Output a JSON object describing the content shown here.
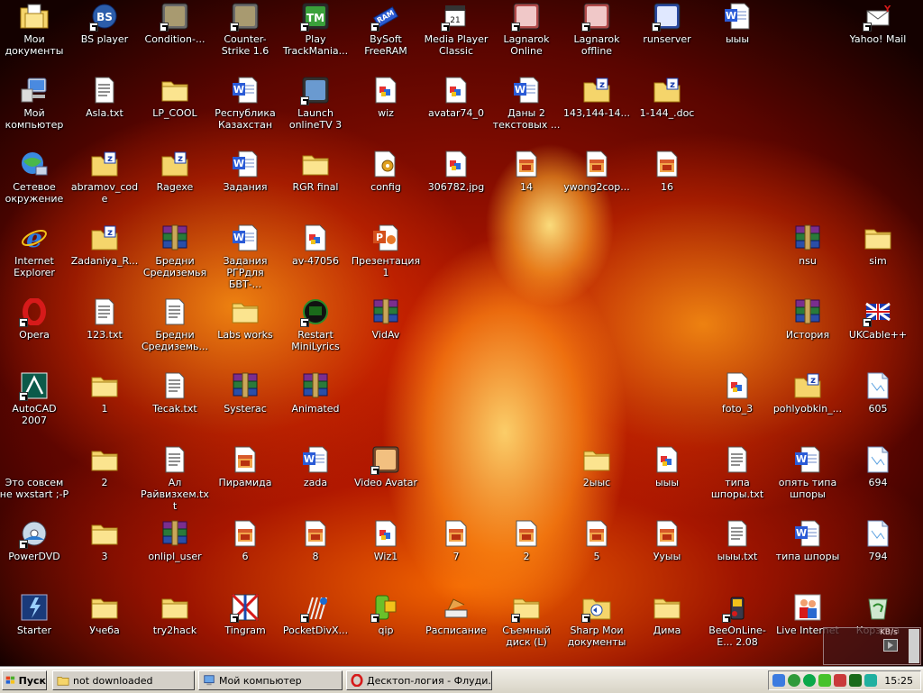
{
  "desktop": {
    "icons": [
      {
        "label": "Мои документы",
        "icon": "my-documents-icon",
        "type": "mydocs",
        "shortcut": false
      },
      {
        "label": "BS player",
        "icon": "bsplayer-icon",
        "type": "app-bs",
        "shortcut": true
      },
      {
        "label": "Condition-...",
        "icon": "counter-strike-icon",
        "type": "app-cs",
        "shortcut": true
      },
      {
        "label": "Counter-Strike 1.6",
        "icon": "counter-strike-icon",
        "type": "app-cs",
        "shortcut": true
      },
      {
        "label": "Play TrackMania...",
        "icon": "trackmania-icon",
        "type": "app-tm",
        "shortcut": true
      },
      {
        "label": "BySoft FreeRAM",
        "icon": "freeram-icon",
        "type": "app-ram",
        "shortcut": true
      },
      {
        "label": "Media Player Classic",
        "icon": "media-player-icon",
        "type": "app-mpc",
        "shortcut": true
      },
      {
        "label": "Lagnarok Online",
        "icon": "ragnarok-icon",
        "type": "app-rag",
        "shortcut": true
      },
      {
        "label": "Lagnarok offline",
        "icon": "ragnarok-icon",
        "type": "app-rag",
        "shortcut": true
      },
      {
        "label": "runserver",
        "icon": "runserver-icon",
        "type": "app-run",
        "shortcut": true
      },
      {
        "label": "ыыы",
        "icon": "word-document-icon",
        "type": "word",
        "shortcut": false
      },
      {
        "label": "Yahoo! Mail",
        "icon": "yahoo-mail-icon",
        "type": "app-yahoo",
        "shortcut": true
      },
      {
        "label": "Мой компьютер",
        "icon": "my-computer-icon",
        "type": "mycomp",
        "shortcut": false
      },
      {
        "label": "Asla.txt",
        "icon": "text-file-icon",
        "type": "txt",
        "shortcut": false
      },
      {
        "label": "LP_COOL",
        "icon": "folder-icon",
        "type": "folder",
        "shortcut": false
      },
      {
        "label": "Республика Казахстан",
        "icon": "word-document-icon",
        "type": "word",
        "shortcut": false
      },
      {
        "label": "Launch onlineTV 3",
        "icon": "onlinetv-icon",
        "type": "app-tv",
        "shortcut": true
      },
      {
        "label": "wiz",
        "icon": "image-file-icon",
        "type": "img",
        "shortcut": false
      },
      {
        "label": "avatar74_0",
        "icon": "image-file-icon",
        "type": "img",
        "shortcut": false
      },
      {
        "label": "Даны 2 текстовых ...",
        "icon": "word-document-icon",
        "type": "word",
        "shortcut": false
      },
      {
        "label": "143,144-14...",
        "icon": "zip-folder-icon",
        "type": "zip",
        "shortcut": false
      },
      {
        "label": "1-144_.doc",
        "icon": "zip-folder-icon",
        "type": "zip",
        "shortcut": false
      },
      {
        "label": "Сетевое окружение",
        "icon": "network-icon",
        "type": "network",
        "shortcut": false
      },
      {
        "label": "abramov_code",
        "icon": "zip-folder-icon",
        "type": "zip",
        "shortcut": false
      },
      {
        "label": "Ragexe",
        "icon": "zip-folder-icon",
        "type": "zip",
        "shortcut": false
      },
      {
        "label": "Задания",
        "icon": "word-document-icon",
        "type": "word",
        "shortcut": false
      },
      {
        "label": "RGR final",
        "icon": "folder-icon",
        "type": "folder",
        "shortcut": false
      },
      {
        "label": "config",
        "icon": "config-file-icon",
        "type": "cfg",
        "shortcut": false
      },
      {
        "label": "306782.jpg",
        "icon": "image-file-icon",
        "type": "img",
        "shortcut": false
      },
      {
        "label": "14",
        "icon": "picture-file-icon",
        "type": "pic",
        "shortcut": false
      },
      {
        "label": "ywong2cop...",
        "icon": "picture-file-icon",
        "type": "pic",
        "shortcut": false
      },
      {
        "label": "16",
        "icon": "picture-file-icon",
        "type": "pic",
        "shortcut": false
      },
      {
        "label": "Internet Explorer",
        "icon": "internet-explorer-icon",
        "type": "ie",
        "shortcut": false
      },
      {
        "label": "Zadaniya_R...",
        "icon": "zip-folder-icon",
        "type": "zip",
        "shortcut": false
      },
      {
        "label": "Бредни Средиземья",
        "icon": "winrar-archive-icon",
        "type": "rar",
        "shortcut": false
      },
      {
        "label": "Задания РГРдля БВТ-...",
        "icon": "word-document-icon",
        "type": "word",
        "shortcut": false
      },
      {
        "label": "av-47056",
        "icon": "image-file-icon",
        "type": "img",
        "shortcut": false
      },
      {
        "label": "Презентация1",
        "icon": "powerpoint-icon",
        "type": "ppt",
        "shortcut": false
      },
      {
        "label": "nsu",
        "icon": "winrar-archive-icon",
        "type": "rar",
        "shortcut": false
      },
      {
        "label": "sim",
        "icon": "folder-icon",
        "type": "folder",
        "shortcut": false
      },
      {
        "label": "Opera",
        "icon": "opera-icon",
        "type": "opera",
        "shortcut": true
      },
      {
        "label": "123.txt",
        "icon": "text-file-icon",
        "type": "txt",
        "shortcut": false
      },
      {
        "label": "Бредни Средиземь...",
        "icon": "text-file-icon",
        "type": "txt",
        "shortcut": false
      },
      {
        "label": "Labs works",
        "icon": "folder-icon",
        "type": "folder",
        "shortcut": false
      },
      {
        "label": "Restart MiniLyrics",
        "icon": "minilyrics-icon",
        "type": "app-ml",
        "shortcut": true
      },
      {
        "label": "VidAv",
        "icon": "winrar-archive-icon",
        "type": "rar",
        "shortcut": false
      },
      {
        "label": "История",
        "icon": "winrar-archive-icon",
        "type": "rar",
        "shortcut": false
      },
      {
        "label": "UKCable++",
        "icon": "ukcable-icon",
        "type": "app-uk",
        "shortcut": true
      },
      {
        "label": "AutoCAD 2007",
        "icon": "autocad-icon",
        "type": "app-acad",
        "shortcut": true
      },
      {
        "label": "1",
        "icon": "folder-icon",
        "type": "folder",
        "shortcut": false
      },
      {
        "label": "Tecak.txt",
        "icon": "text-file-icon",
        "type": "txt",
        "shortcut": false
      },
      {
        "label": "Systerac",
        "icon": "winrar-archive-icon",
        "type": "rar",
        "shortcut": false
      },
      {
        "label": "Animated",
        "icon": "winrar-archive-icon",
        "type": "rar",
        "shortcut": false
      },
      {
        "label": "foto_3",
        "icon": "image-file-icon",
        "type": "img",
        "shortcut": false
      },
      {
        "label": "pohlyobkin_...",
        "icon": "zip-folder-icon",
        "type": "zip",
        "shortcut": false
      },
      {
        "label": "605",
        "icon": "blank-file-icon",
        "type": "blank",
        "shortcut": false
      },
      {
        "label": "Это совсем не wxstart ;-P",
        "icon": "blank-icon",
        "type": "none",
        "shortcut": false
      },
      {
        "label": "2",
        "icon": "folder-icon",
        "type": "folder",
        "shortcut": false
      },
      {
        "label": "Ал Райвизхем.txt",
        "icon": "text-file-icon",
        "type": "txt",
        "shortcut": false
      },
      {
        "label": "Пирамида",
        "icon": "picture-file-icon",
        "type": "pic",
        "shortcut": false
      },
      {
        "label": "zada",
        "icon": "word-document-icon",
        "type": "word",
        "shortcut": false
      },
      {
        "label": "Video Avatar",
        "icon": "video-avatar-icon",
        "type": "app-va",
        "shortcut": true
      },
      {
        "label": "2ыыс",
        "icon": "folder-icon",
        "type": "folder",
        "shortcut": false
      },
      {
        "label": "ыыы",
        "icon": "image-file-icon",
        "type": "img",
        "shortcut": false
      },
      {
        "label": "типа шпоры.txt",
        "icon": "text-file-icon",
        "type": "txt",
        "shortcut": false
      },
      {
        "label": "опять типа шпоры",
        "icon": "word-document-icon",
        "type": "word",
        "shortcut": false
      },
      {
        "label": "694",
        "icon": "blank-file-icon",
        "type": "blank",
        "shortcut": false
      },
      {
        "label": "PowerDVD",
        "icon": "powerdvd-icon",
        "type": "app-dvd",
        "shortcut": true
      },
      {
        "label": "3",
        "icon": "folder-icon",
        "type": "folder",
        "shortcut": false
      },
      {
        "label": "onlipl_user",
        "icon": "winrar-archive-icon",
        "type": "rar",
        "shortcut": false
      },
      {
        "label": "6",
        "icon": "picture-file-icon",
        "type": "pic",
        "shortcut": false
      },
      {
        "label": "8",
        "icon": "picture-file-icon",
        "type": "pic",
        "shortcut": false
      },
      {
        "label": "Wiz1",
        "icon": "image-file-icon",
        "type": "img",
        "shortcut": false
      },
      {
        "label": "7",
        "icon": "picture-file-icon",
        "type": "pic",
        "shortcut": false
      },
      {
        "label": "2",
        "icon": "picture-file-icon",
        "type": "pic",
        "shortcut": false
      },
      {
        "label": "5",
        "icon": "picture-file-icon",
        "type": "pic",
        "shortcut": false
      },
      {
        "label": "Ууыы",
        "icon": "picture-file-icon",
        "type": "pic",
        "shortcut": false
      },
      {
        "label": "ыыы.txt",
        "icon": "text-file-icon",
        "type": "txt",
        "shortcut": false
      },
      {
        "label": "типа шпоры",
        "icon": "word-document-icon",
        "type": "word",
        "shortcut": false
      },
      {
        "label": "794",
        "icon": "blank-file-icon",
        "type": "blank",
        "shortcut": false
      },
      {
        "label": "Starter",
        "icon": "starter-icon",
        "type": "app-starter",
        "shortcut": false
      },
      {
        "label": "Учеба",
        "icon": "folder-icon",
        "type": "folder",
        "shortcut": false
      },
      {
        "label": "try2hack",
        "icon": "folder-icon",
        "type": "folder",
        "shortcut": false
      },
      {
        "label": "Tingram",
        "icon": "tingram-icon",
        "type": "app-ting",
        "shortcut": true
      },
      {
        "label": "PocketDivX...",
        "icon": "pocketdivx-icon",
        "type": "app-pdx",
        "shortcut": true
      },
      {
        "label": "qip",
        "icon": "qip-icon",
        "type": "app-qip",
        "shortcut": true
      },
      {
        "label": "Расписание",
        "icon": "schedule-icon",
        "type": "app-sched",
        "shortcut": false
      },
      {
        "label": "Съемный диск (L)",
        "icon": "folder-icon",
        "type": "folder",
        "shortcut": true
      },
      {
        "label": "Sharp Мои документы",
        "icon": "shared-folder-icon",
        "type": "shared",
        "shortcut": true
      },
      {
        "label": "Дима",
        "icon": "folder-icon",
        "type": "folder",
        "shortcut": false
      },
      {
        "label": "BeeOnLine-E... 2.08",
        "icon": "beeonline-icon",
        "type": "app-bee",
        "shortcut": true
      },
      {
        "label": "Live Internet",
        "icon": "live-internet-icon",
        "type": "app-li",
        "shortcut": false
      },
      {
        "label": "Корзина",
        "icon": "recycle-bin-icon",
        "type": "recycle",
        "shortcut": false
      }
    ]
  },
  "netmeter": {
    "rate": "KB/s"
  },
  "taskbar": {
    "start_label": "Пуск",
    "tasks": [
      {
        "label": "not downloaded",
        "icon": "folder-icon"
      },
      {
        "label": "Мой компьютер",
        "icon": "my-computer-icon"
      },
      {
        "label": "Десктоп-логия - Флуди...",
        "icon": "opera-icon"
      }
    ],
    "tray_icons": [
      "network-tray-icon",
      "globe-tray-icon",
      "green-status-icon",
      "icq-flower-icon",
      "volume-icon",
      "battery-icon",
      "refresh-tray-icon"
    ],
    "clock": "15:25"
  },
  "colors": {
    "taskbar": "#d4d0c8",
    "folder": "#f5d56b",
    "word": "#2a5bd7",
    "winrar": "#7a2e8e"
  }
}
